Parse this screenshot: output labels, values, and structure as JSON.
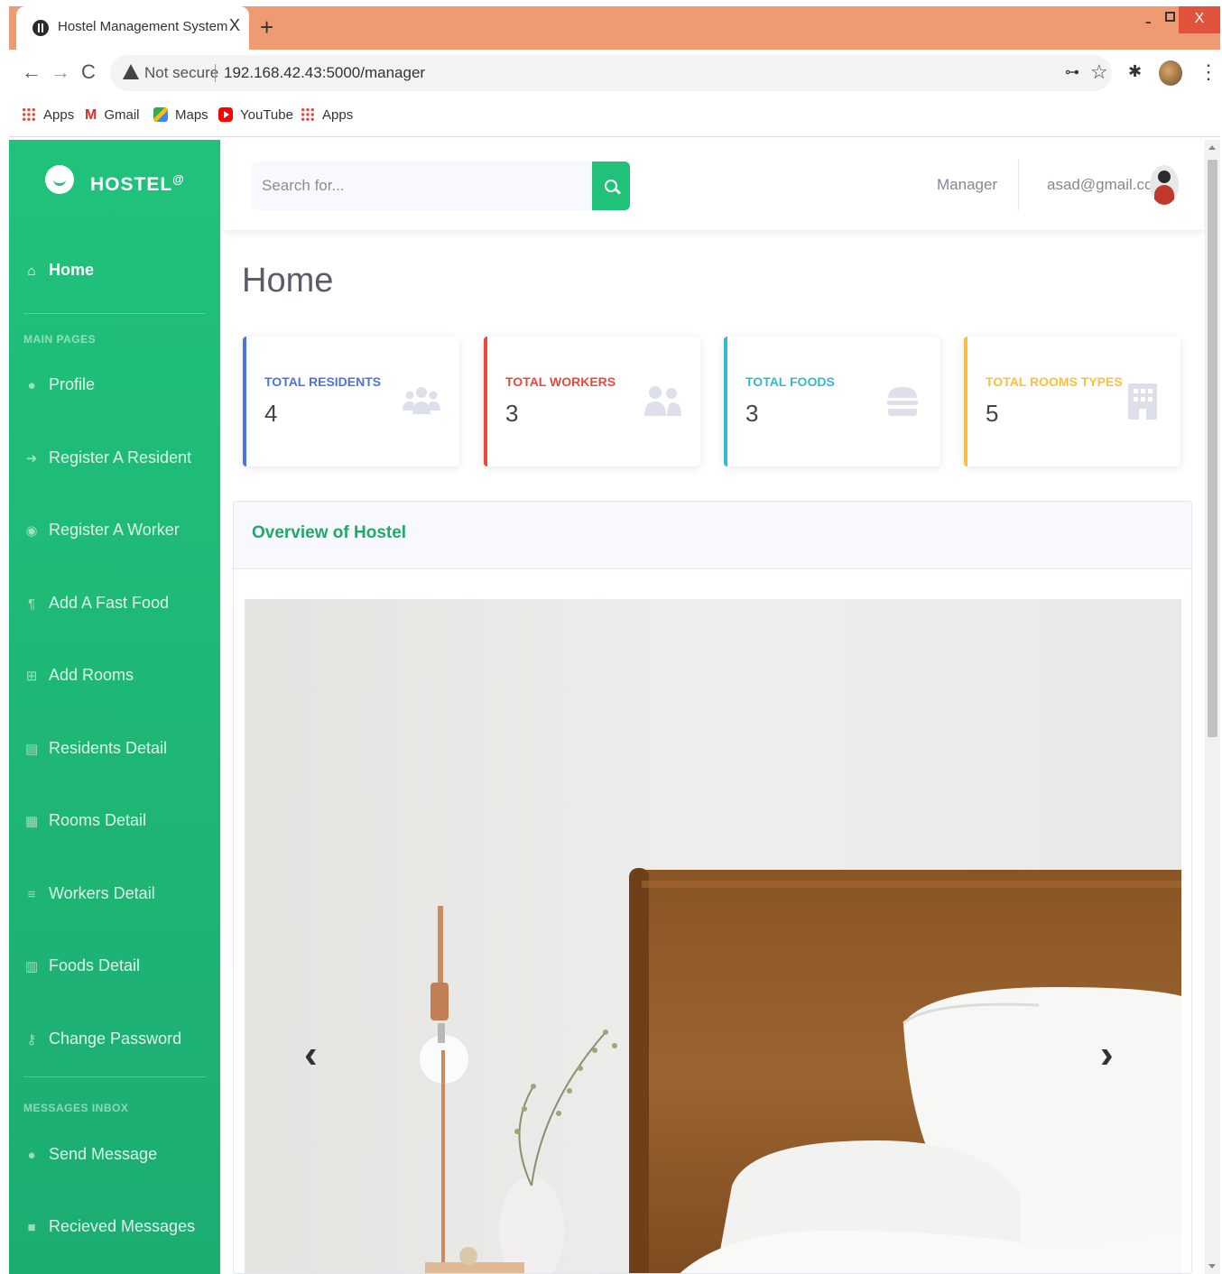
{
  "browser": {
    "tab_title": "Hostel Management System",
    "tab_close": "X",
    "new_tab": "+",
    "window_controls": {
      "minimize": "-",
      "close": "X"
    },
    "not_secure": "Not secure",
    "url": "192.168.42.43:5000/manager",
    "bookmarks": [
      {
        "label": "Apps",
        "icon": "apps-grid-icon"
      },
      {
        "label": "Gmail",
        "icon": "gmail-icon"
      },
      {
        "label": "Maps",
        "icon": "maps-icon"
      },
      {
        "label": "YouTube",
        "icon": "youtube-icon"
      },
      {
        "label": "Apps",
        "icon": "apps-grid-icon"
      }
    ]
  },
  "sidebar": {
    "brand": "HOSTEL",
    "brand_sup": "@",
    "home": "Home",
    "main_heading": "MAIN PAGES",
    "items": [
      {
        "label": "Profile",
        "icon": "user-icon"
      },
      {
        "label": "Register A Resident",
        "icon": "sign-in-icon"
      },
      {
        "label": "Register A Worker",
        "icon": "id-badge-icon"
      },
      {
        "label": "Add A Fast Food",
        "icon": "utensils-icon"
      },
      {
        "label": "Add Rooms",
        "icon": "plus-square-icon"
      },
      {
        "label": "Residents Detail",
        "icon": "id-card-icon"
      },
      {
        "label": "Rooms Detail",
        "icon": "calendar-icon"
      },
      {
        "label": "Workers Detail",
        "icon": "list-icon"
      },
      {
        "label": "Foods Detail",
        "icon": "table-icon"
      },
      {
        "label": "Change Password",
        "icon": "key-icon"
      }
    ],
    "inbox_heading": "MESSAGES INBOX",
    "inbox_items": [
      {
        "label": "Send Message",
        "icon": "comment-icon"
      },
      {
        "label": "Recieved Messages",
        "icon": "inbox-icon"
      }
    ]
  },
  "topbar": {
    "search_placeholder": "Search for...",
    "role": "Manager",
    "email": "asad@gmail.com"
  },
  "page": {
    "title": "Home"
  },
  "cards": [
    {
      "label": "TOTAL RESIDENTS",
      "value": "4",
      "color": "#4e73df",
      "icon": "users-icon"
    },
    {
      "label": "TOTAL WORKERS",
      "value": "3",
      "color": "#e74a3b",
      "icon": "user-friends-icon"
    },
    {
      "label": "TOTAL FOODS",
      "value": "3",
      "color": "#36b9cc",
      "icon": "hamburger-icon"
    },
    {
      "label": "TOTAL ROOMS TYPES",
      "value": "5",
      "color": "#f6c23e",
      "icon": "building-icon"
    }
  ],
  "overview": {
    "title": "Overview of Hostel",
    "carousel_prev": "‹",
    "carousel_next": "›"
  },
  "colors": {
    "brand_green": "#20c27a",
    "tab_strip": "#ee9a72"
  }
}
